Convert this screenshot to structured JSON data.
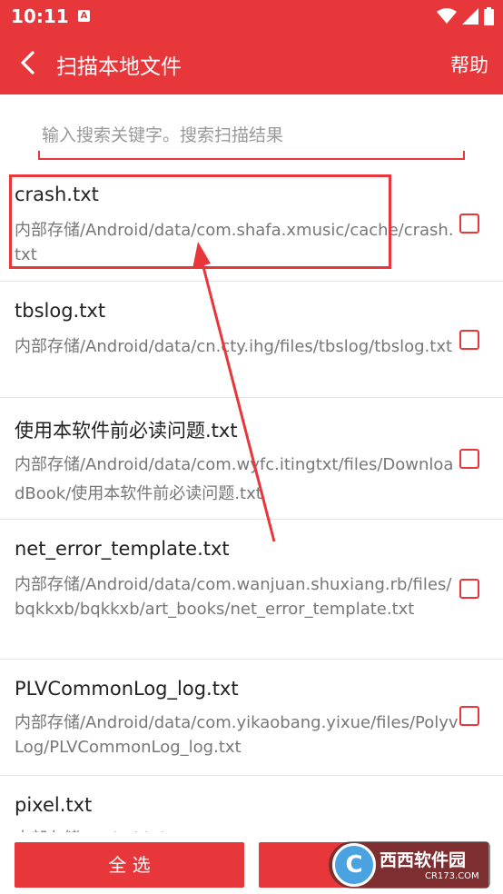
{
  "status_bar": {
    "time": "10:11",
    "notification_icon": "A",
    "icons": [
      "wifi-icon",
      "signal-icon",
      "battery-icon"
    ]
  },
  "title_bar": {
    "title": "扫描本地文件",
    "help_label": "帮助",
    "back_icon": "chevron-left-icon"
  },
  "search": {
    "placeholder": "输入搜索关键字。搜索扫描结果",
    "value": ""
  },
  "files": [
    {
      "name": "crash.txt",
      "path": "内部存储/Android/data/com.shafa.xmusic/cache/crash.txt",
      "checked": false
    },
    {
      "name": "tbslog.txt",
      "path": "内部存储/Android/data/cn.cty.ihg/files/tbslog/tbslog.txt",
      "checked": false
    },
    {
      "name": "使用本软件前必读问题.txt",
      "path": "内部存储/Android/data/com.wyfc.itingtxt/files/DownloadBook/使用本软件前必读问题.txt",
      "checked": false
    },
    {
      "name": "net_error_template.txt",
      "path": "内部存储/Android/data/com.wanjuan.shuxiang.rb/files/bqkkxb/bqkkxb/art_books/net_error_template.txt",
      "checked": false
    },
    {
      "name": "PLVCommonLog_log.txt",
      "path": "内部存储/Android/data/com.yikaobang.yixue/files/PolyvLog/PLVCommonLog_log.txt",
      "checked": false
    },
    {
      "name": "pixel.txt",
      "path": "内部存储/Android/data/...",
      "checked": false
    }
  ],
  "bottom": {
    "select_all_label": "全 选",
    "second_label": ""
  },
  "watermark": {
    "brand": "西西软件园",
    "domain": "CR173.COM"
  },
  "colors": {
    "primary": "#e8373b",
    "text_primary": "#222222",
    "text_secondary": "#777777"
  }
}
